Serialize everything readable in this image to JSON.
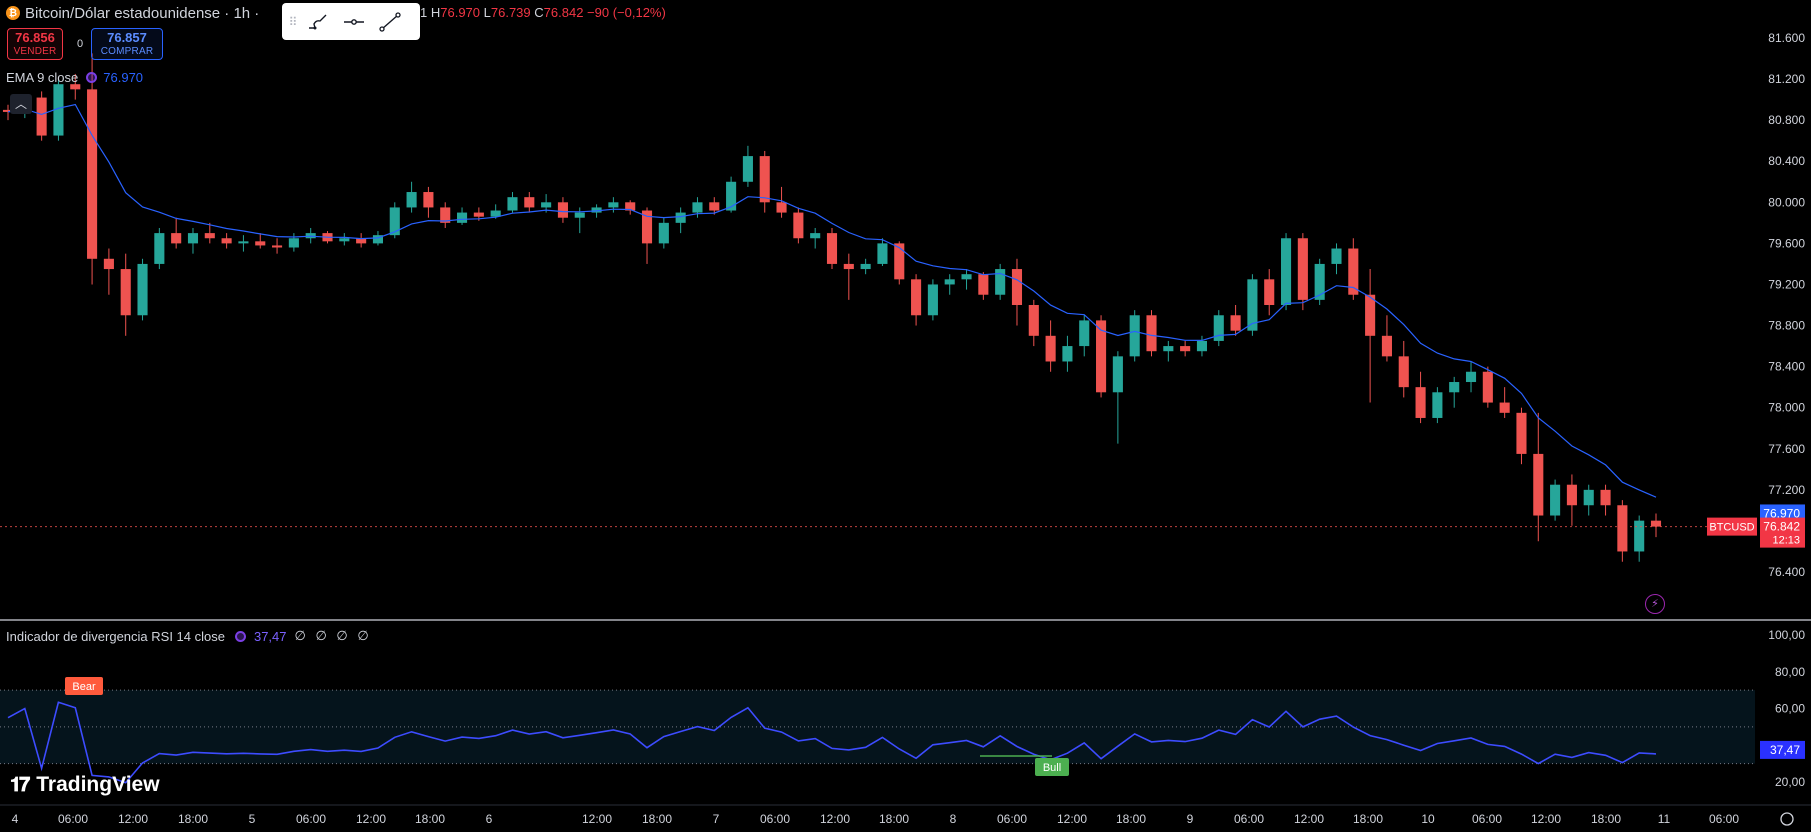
{
  "header": {
    "symbol_title": "Bitcoin/Dólar estadounidense · 1h ·",
    "ohlc": {
      "h_label": "H",
      "h_value": "76.970",
      "l_label": "L",
      "l_value": "76.739",
      "c_label": "C",
      "c_value": "76.842",
      "change": "−90 (−0,12%)",
      "partial_prefix": "1"
    }
  },
  "toolbar": {
    "tools": [
      "trend-brush-icon",
      "horizontal-ray-icon",
      "trend-line-icon"
    ]
  },
  "trade": {
    "sell_price": "76.856",
    "sell_label": "VENDER",
    "spread": "0",
    "buy_price": "76.857",
    "buy_label": "COMPRAR"
  },
  "ema_legend": {
    "label": "EMA 9 close",
    "value": "76.970"
  },
  "rsi_legend": {
    "label": "Indicador de divergencia RSI 14 close",
    "value": "37,47",
    "extras": "∅ ∅ ∅ ∅"
  },
  "price_axis": {
    "ticks": [
      "81.600",
      "81.200",
      "80.800",
      "80.400",
      "80.000",
      "79.600",
      "79.200",
      "78.800",
      "78.400",
      "78.000",
      "77.600",
      "77.200",
      "76.400"
    ]
  },
  "price_labels": {
    "ema_value": "76.970",
    "last_price": "76.842",
    "countdown": "12:13",
    "symbol": "BTCUSD"
  },
  "rsi_axis": {
    "ticks": [
      "100,00",
      "80,00",
      "60,00",
      "20,00"
    ],
    "current": "37,47"
  },
  "rsi_markers": {
    "bear": "Bear",
    "bull": "Bull"
  },
  "time_axis": {
    "ticks": [
      "4",
      "06:00",
      "12:00",
      "18:00",
      "5",
      "06:00",
      "12:00",
      "18:00",
      "6",
      "12:00",
      "18:00",
      "7",
      "06:00",
      "12:00",
      "18:00",
      "8",
      "06:00",
      "12:00",
      "18:00",
      "9",
      "06:00",
      "12:00",
      "18:00",
      "10",
      "06:00",
      "12:00",
      "18:00",
      "11",
      "06:00"
    ]
  },
  "branding": {
    "name": "TradingView"
  },
  "colors": {
    "up": "#26a69a",
    "down": "#ef5350",
    "ema": "#2962ff",
    "rsi": "#3d4cff",
    "background": "#000000"
  },
  "chart_data": {
    "type": "candlestick",
    "interval": "1h",
    "series_ohlc_approx": [
      [
        80900,
        80950,
        80800,
        80880
      ],
      [
        80880,
        81050,
        80820,
        81020
      ],
      [
        81020,
        81080,
        80600,
        80650
      ],
      [
        80650,
        81200,
        80600,
        81150
      ],
      [
        81150,
        81250,
        81000,
        81100
      ],
      [
        81100,
        81450,
        79200,
        79450
      ],
      [
        79450,
        79550,
        79100,
        79350
      ],
      [
        79350,
        79500,
        78700,
        78900
      ],
      [
        78900,
        79450,
        78850,
        79400
      ],
      [
        79400,
        79750,
        79350,
        79700
      ],
      [
        79700,
        79850,
        79550,
        79600
      ],
      [
        79600,
        79750,
        79500,
        79700
      ],
      [
        79700,
        79800,
        79600,
        79650
      ],
      [
        79650,
        79700,
        79550,
        79600
      ],
      [
        79600,
        79680,
        79520,
        79620
      ],
      [
        79620,
        79700,
        79550,
        79580
      ],
      [
        79580,
        79650,
        79500,
        79560
      ],
      [
        79560,
        79700,
        79520,
        79650
      ],
      [
        79650,
        79750,
        79600,
        79700
      ],
      [
        79700,
        79720,
        79600,
        79620
      ],
      [
        79620,
        79700,
        79580,
        79650
      ],
      [
        79650,
        79700,
        79560,
        79600
      ],
      [
        79600,
        79720,
        79580,
        79680
      ],
      [
        79680,
        80000,
        79650,
        79950
      ],
      [
        79950,
        80200,
        79900,
        80100
      ],
      [
        80100,
        80150,
        79850,
        79950
      ],
      [
        79950,
        80000,
        79750,
        79800
      ],
      [
        79800,
        79950,
        79780,
        79900
      ],
      [
        79900,
        79950,
        79820,
        79860
      ],
      [
        79860,
        79980,
        79840,
        79920
      ],
      [
        79920,
        80100,
        79900,
        80050
      ],
      [
        80050,
        80100,
        79900,
        79950
      ],
      [
        79950,
        80080,
        79900,
        80000
      ],
      [
        80000,
        80050,
        79800,
        79850
      ],
      [
        79850,
        79950,
        79700,
        79900
      ],
      [
        79900,
        79980,
        79850,
        79950
      ],
      [
        79950,
        80050,
        79900,
        80000
      ],
      [
        80000,
        80020,
        79880,
        79920
      ],
      [
        79920,
        79950,
        79400,
        79600
      ],
      [
        79600,
        79850,
        79550,
        79800
      ],
      [
        79800,
        79950,
        79700,
        79900
      ],
      [
        79900,
        80050,
        79850,
        80000
      ],
      [
        80000,
        80050,
        79880,
        79920
      ],
      [
        79920,
        80250,
        79900,
        80200
      ],
      [
        80200,
        80550,
        80150,
        80450
      ],
      [
        80450,
        80500,
        79900,
        80000
      ],
      [
        80000,
        80150,
        79850,
        79900
      ],
      [
        79900,
        79950,
        79600,
        79650
      ],
      [
        79650,
        79750,
        79550,
        79700
      ],
      [
        79700,
        79750,
        79350,
        79400
      ],
      [
        79400,
        79500,
        79050,
        79350
      ],
      [
        79350,
        79450,
        79300,
        79400
      ],
      [
        79400,
        79650,
        79380,
        79600
      ],
      [
        79600,
        79620,
        79200,
        79250
      ],
      [
        79250,
        79300,
        78800,
        78900
      ],
      [
        78900,
        79250,
        78850,
        79200
      ],
      [
        79200,
        79300,
        79100,
        79250
      ],
      [
        79250,
        79350,
        79150,
        79300
      ],
      [
        79300,
        79320,
        79050,
        79100
      ],
      [
        79100,
        79400,
        79050,
        79350
      ],
      [
        79350,
        79450,
        78800,
        79000
      ],
      [
        79000,
        79050,
        78600,
        78700
      ],
      [
        78700,
        78850,
        78350,
        78450
      ],
      [
        78450,
        78700,
        78350,
        78600
      ],
      [
        78600,
        78900,
        78500,
        78850
      ],
      [
        78850,
        78900,
        78100,
        78150
      ],
      [
        78150,
        78550,
        77650,
        78500
      ],
      [
        78500,
        78950,
        78450,
        78900
      ],
      [
        78900,
        78950,
        78500,
        78550
      ],
      [
        78550,
        78650,
        78450,
        78600
      ],
      [
        78600,
        78650,
        78500,
        78550
      ],
      [
        78550,
        78700,
        78500,
        78650
      ],
      [
        78650,
        78950,
        78600,
        78900
      ],
      [
        78900,
        79000,
        78700,
        78750
      ],
      [
        78750,
        79300,
        78700,
        79250
      ],
      [
        79250,
        79350,
        78900,
        79000
      ],
      [
        79000,
        79700,
        78950,
        79650
      ],
      [
        79650,
        79700,
        78950,
        79050
      ],
      [
        79050,
        79450,
        79000,
        79400
      ],
      [
        79400,
        79600,
        79300,
        79550
      ],
      [
        79550,
        79650,
        79050,
        79100
      ],
      [
        79100,
        79350,
        78050,
        78700
      ],
      [
        78700,
        78900,
        78450,
        78500
      ],
      [
        78500,
        78650,
        78100,
        78200
      ],
      [
        78200,
        78350,
        77850,
        77900
      ],
      [
        77900,
        78200,
        77850,
        78150
      ],
      [
        78150,
        78300,
        78000,
        78250
      ],
      [
        78250,
        78450,
        78150,
        78350
      ],
      [
        78350,
        78400,
        78000,
        78050
      ],
      [
        78050,
        78200,
        77900,
        77950
      ],
      [
        77950,
        78000,
        77450,
        77550
      ],
      [
        77550,
        77950,
        76700,
        76950
      ],
      [
        76950,
        77300,
        76900,
        77250
      ],
      [
        77250,
        77350,
        76850,
        77050
      ],
      [
        77050,
        77250,
        76950,
        77200
      ],
      [
        77200,
        77250,
        76950,
        77050
      ],
      [
        77050,
        77100,
        76500,
        76600
      ],
      [
        76600,
        76950,
        76500,
        76900
      ],
      [
        76900,
        76970,
        76739,
        76842
      ]
    ],
    "ema": {
      "name": "EMA 9 close",
      "last": 76970
    },
    "rsi": {
      "name": "RSI 14",
      "last": 37.47,
      "upper": 70,
      "middle": 50,
      "lower": 30,
      "range": [
        20,
        100
      ]
    },
    "y_range": [
      76000,
      81800
    ],
    "x_range_label": [
      "4",
      "06:00"
    ]
  }
}
